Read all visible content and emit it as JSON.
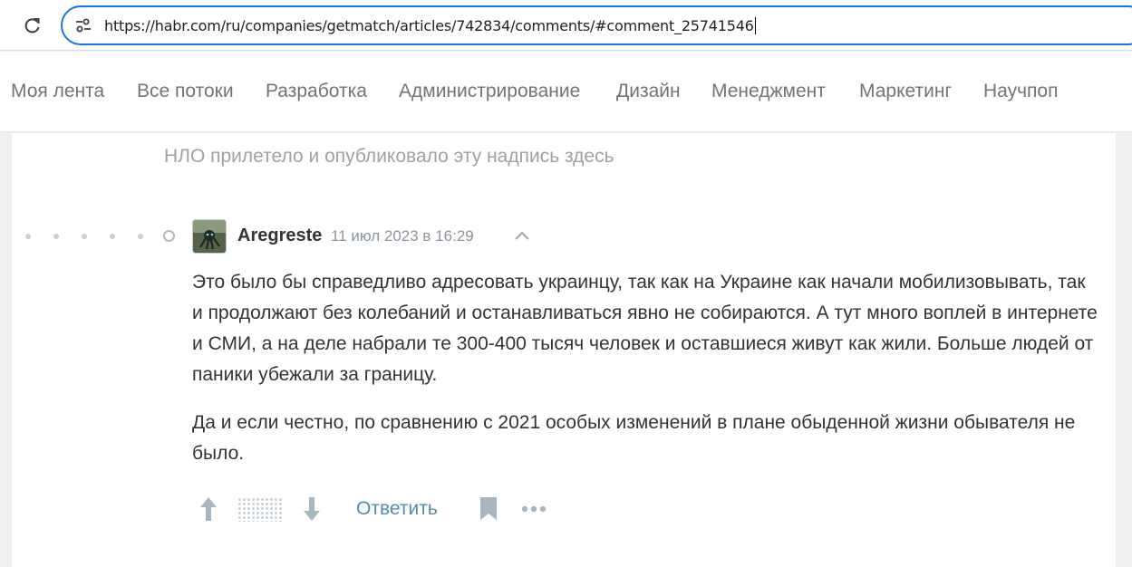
{
  "browser": {
    "url": "https://habr.com/ru/companies/getmatch/articles/742834/comments/#comment_25741546"
  },
  "nav": {
    "items": [
      "Моя лента",
      "Все потоки",
      "Разработка",
      "Администрирование",
      "Дизайн",
      "Менеджмент",
      "Маркетинг",
      "Научпоп"
    ]
  },
  "notice": "НЛО прилетело и опубликовало эту надпись здесь",
  "comment": {
    "author": "Aregreste",
    "date": "11 июл 2023 в 16:29",
    "paragraphs": [
      "Это было бы справедливо адресовать украинцу, так как на Украине как начали мобилизовывать, так и продолжают без колебаний и останавливаться явно не собираются. А тут много воплей в интернете и СМИ, а на деле набрали те 300-400 тысяч человек и оставшиеся живут как жили. Больше людей от паники убежали за границу.",
      "Да и если честно, по сравнению с 2021 особых изменений в плане обыденной жизни обывателя не было."
    ],
    "reply_label": "Ответить"
  },
  "colors": {
    "accent": "#548eaa",
    "url_focus": "#1a73e8"
  },
  "icons": [
    "reload-icon",
    "site-info-icon",
    "collapse-chevron-icon",
    "upvote-icon",
    "downvote-icon",
    "bookmark-icon",
    "more-icon"
  ]
}
